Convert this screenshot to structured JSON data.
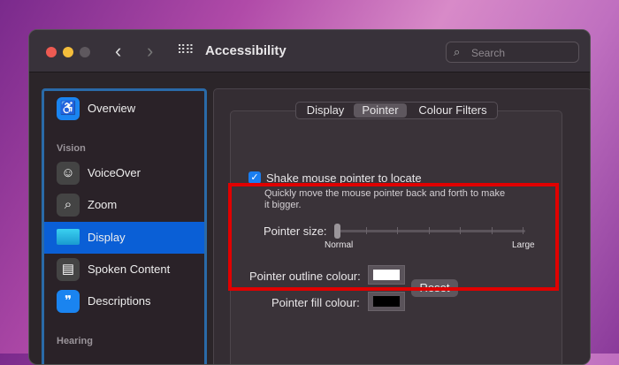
{
  "window": {
    "title": "Accessibility",
    "search_placeholder": "Search"
  },
  "sidebar": {
    "items": [
      {
        "label": "Overview",
        "icon": "accessibility-icon"
      },
      {
        "label": "VoiceOver",
        "icon": "voiceover-icon"
      },
      {
        "label": "Zoom",
        "icon": "zoom-icon"
      },
      {
        "label": "Display",
        "icon": "display-icon",
        "selected": true
      },
      {
        "label": "Spoken Content",
        "icon": "spoken-content-icon"
      },
      {
        "label": "Descriptions",
        "icon": "descriptions-icon"
      }
    ],
    "sections": {
      "vision": "Vision",
      "hearing": "Hearing"
    }
  },
  "tabs": [
    "Display",
    "Pointer",
    "Colour Filters"
  ],
  "pointer": {
    "shake_label": "Shake mouse pointer to locate",
    "shake_checked": true,
    "shake_desc_1": "Quickly move the mouse pointer back and forth to make",
    "shake_desc_2": "it bigger.",
    "size_label": "Pointer size:",
    "size_value": 0,
    "size_min_label": "Normal",
    "size_max_label": "Large",
    "outline_label": "Pointer outline colour:",
    "outline_color": "#ffffff",
    "fill_label": "Pointer fill colour:",
    "fill_color": "#000000",
    "reset_label": "Reset"
  },
  "colors": {
    "accent": "#0a5fd6",
    "highlight": "#e00000"
  }
}
